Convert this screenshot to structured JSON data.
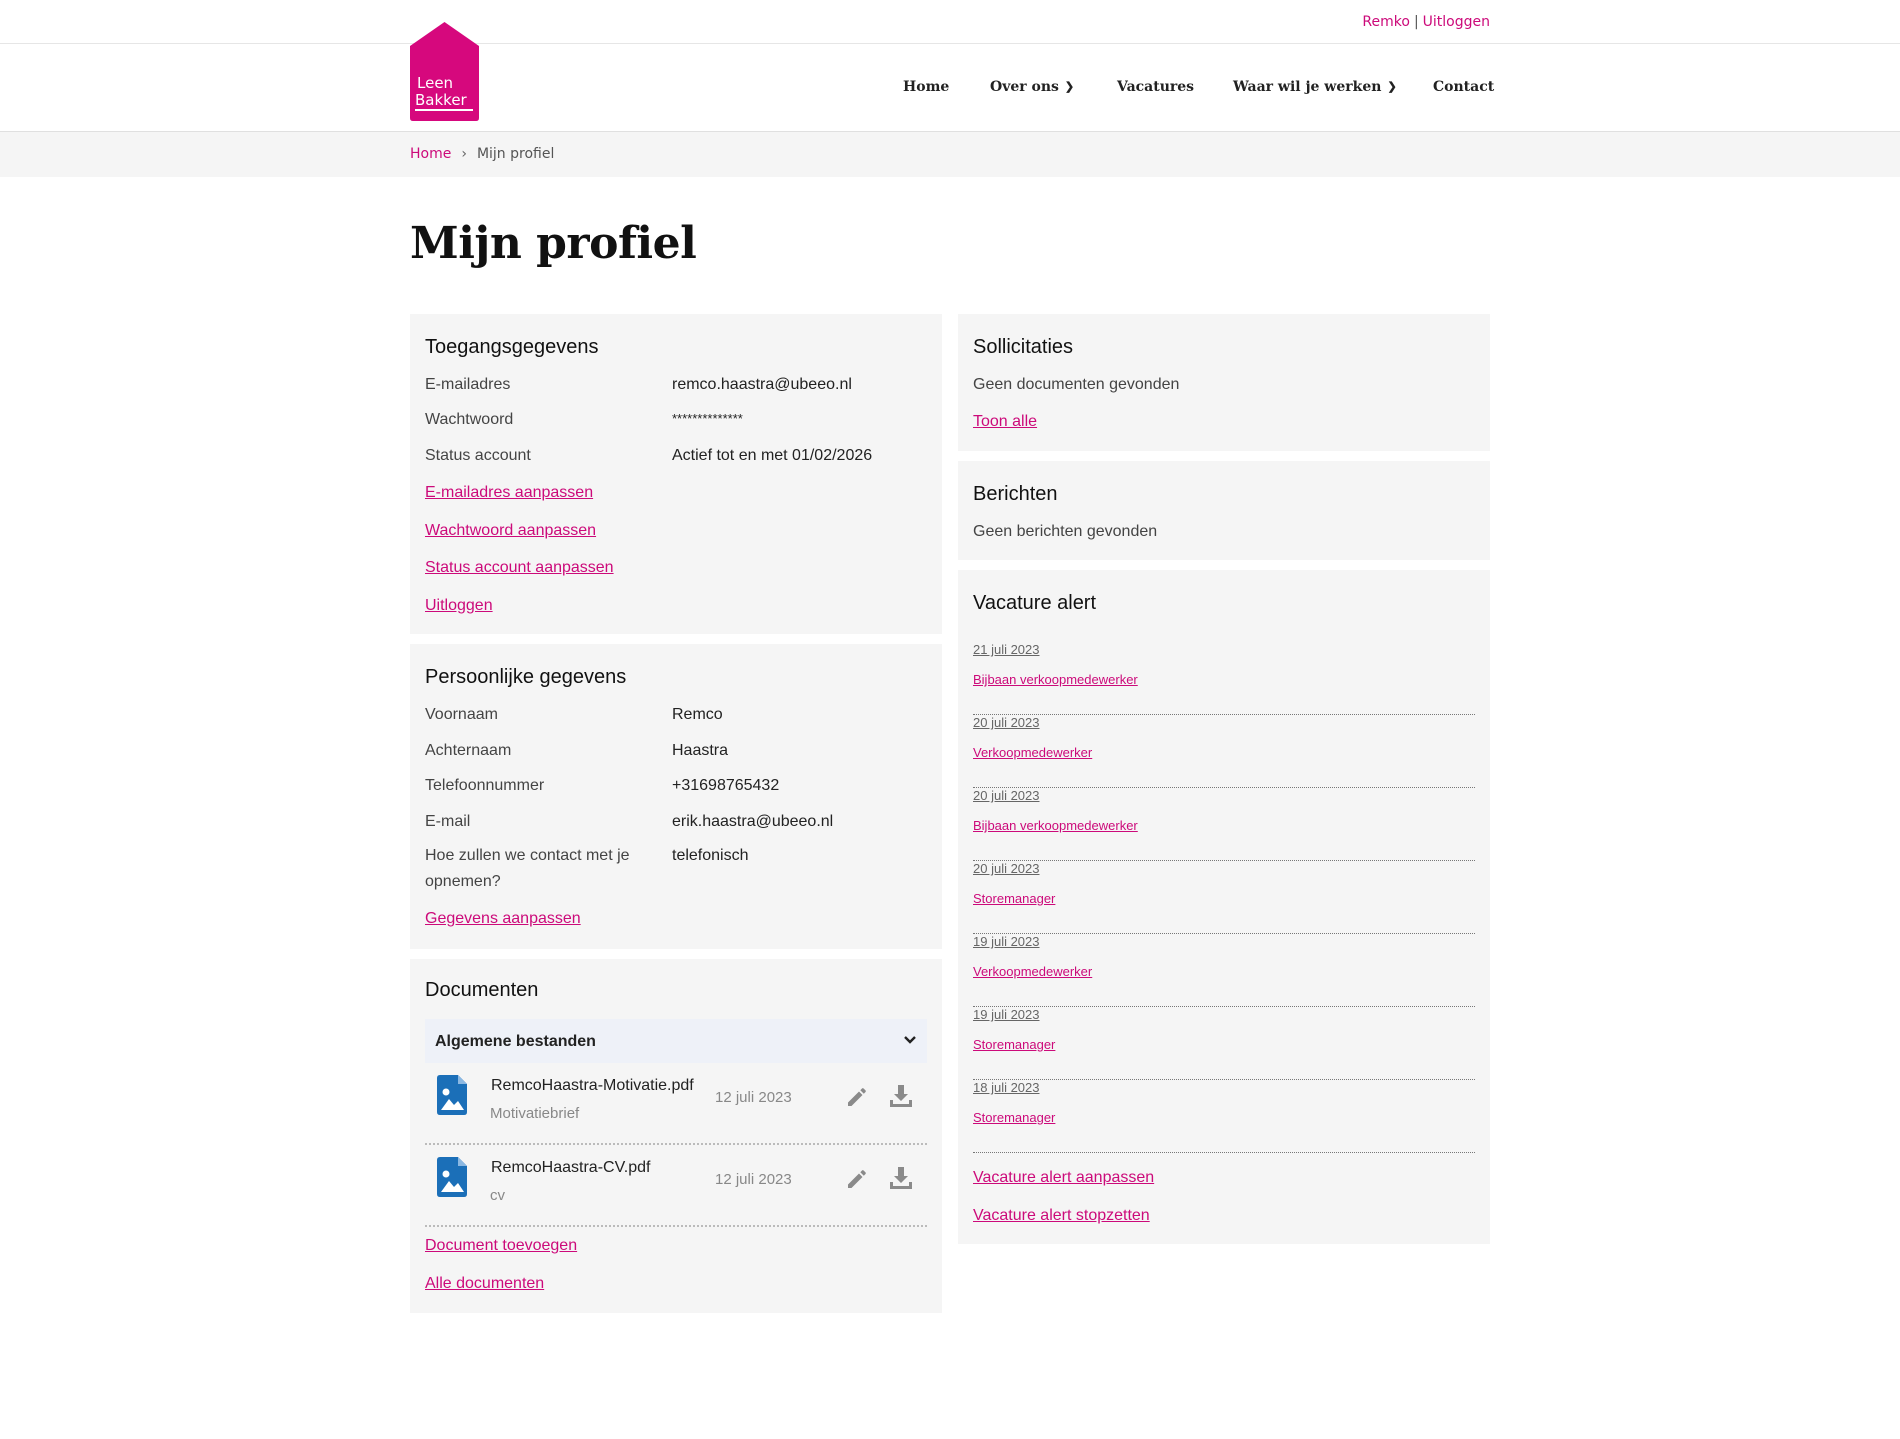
{
  "topbar": {
    "user": "Remko",
    "separator": "|",
    "logout": "Uitloggen"
  },
  "logo": {
    "line1": "Leen",
    "line2": "Bakker"
  },
  "nav": {
    "home": "Home",
    "about": "Over ons",
    "jobs": "Vacatures",
    "where": "Waar wil je werken",
    "contact": "Contact"
  },
  "breadcrumb": {
    "home": "Home",
    "arrow": "›",
    "current": "Mijn profiel"
  },
  "page": {
    "title": "Mijn profiel"
  },
  "access": {
    "title": "Toegangsgegevens",
    "rows": [
      {
        "label": "E-mailadres",
        "value": "remco.haastra@ubeeo.nl"
      },
      {
        "label": "Wachtwoord",
        "value": "**************"
      },
      {
        "label": "Status account",
        "value": "Actief tot en met 01/02/2026"
      }
    ],
    "links": [
      "E-mailadres aanpassen",
      "Wachtwoord aanpassen",
      "Status account aanpassen",
      "Uitloggen"
    ]
  },
  "personal": {
    "title": "Persoonlijke gegevens",
    "rows": [
      {
        "label": "Voornaam",
        "value": "Remco"
      },
      {
        "label": "Achternaam",
        "value": "Haastra"
      },
      {
        "label": "Telefoonnummer",
        "value": "+31698765432"
      },
      {
        "label": "E-mail",
        "value": "erik.haastra@ubeeo.nl"
      },
      {
        "label_line1": "Hoe zullen we contact met je",
        "label_line2": "opnemen?",
        "value": "telefonisch"
      }
    ],
    "edit_link": "Gegevens aanpassen"
  },
  "documents": {
    "title": "Documenten",
    "group": "Algemene bestanden",
    "files": [
      {
        "name": "RemcoHaastra-Motivatie.pdf",
        "type": "Motivatiebrief",
        "date": "12 juli 2023"
      },
      {
        "name": "RemcoHaastra-CV.pdf",
        "type": "cv",
        "date": "12 juli 2023"
      }
    ],
    "add_link": "Document toevoegen",
    "all_link": "Alle documenten"
  },
  "applications": {
    "title": "Sollicitaties",
    "empty": "Geen documenten gevonden",
    "show_all": "Toon alle"
  },
  "messages": {
    "title": "Berichten",
    "empty": "Geen berichten gevonden"
  },
  "alerts": {
    "title": "Vacature alert",
    "items": [
      {
        "date": "21 juli 2023",
        "title": "Bijbaan verkoopmedewerker"
      },
      {
        "date": "20 juli 2023",
        "title": "Verkoopmedewerker"
      },
      {
        "date": "20 juli 2023",
        "title": "Bijbaan verkoopmedewerker"
      },
      {
        "date": "20 juli 2023",
        "title": "Storemanager"
      },
      {
        "date": "19 juli 2023",
        "title": "Verkoopmedewerker"
      },
      {
        "date": "19 juli 2023",
        "title": "Storemanager"
      },
      {
        "date": "18 juli 2023",
        "title": "Storemanager"
      }
    ],
    "edit_link": "Vacature alert aanpassen",
    "stop_link": "Vacature alert stopzetten"
  },
  "colors": {
    "brand": "#cc0a7a",
    "panel": "#f5f5f5",
    "file_icon": "#1b6fb8",
    "accordion": "#eef1f8"
  }
}
